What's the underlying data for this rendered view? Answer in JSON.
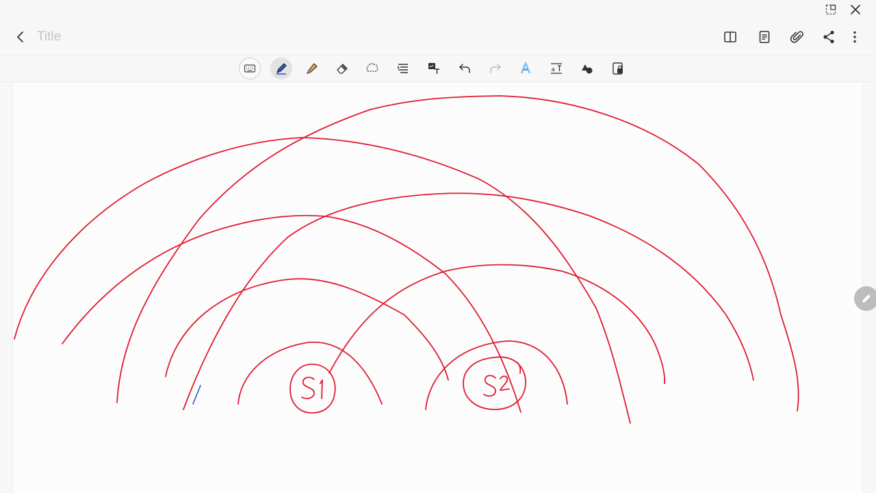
{
  "window": {
    "controls": [
      "popup-view-icon",
      "close-icon"
    ]
  },
  "header": {
    "back_icon": "chevron-left-icon",
    "title_placeholder": "Title",
    "title_value": "",
    "actions": [
      "book-view-icon",
      "page-template-icon",
      "attachment-icon",
      "share-icon",
      "more-options-icon"
    ]
  },
  "toolbar": {
    "tools": [
      "keyboard",
      "pen",
      "highlighter",
      "eraser",
      "lasso",
      "text-align",
      "handwriting-to-text",
      "undo",
      "redo",
      "text-style",
      "text-spacing",
      "shapes",
      "read-only-lock"
    ],
    "selected": "pen",
    "colors": {
      "pen_accent": "#2a5bd7",
      "highlighter": "#f2a64a",
      "active_text": "#2a8fe0"
    }
  },
  "canvas": {
    "labels": [
      "S1",
      "S2"
    ],
    "ink_color": "#e01b2f",
    "accent_stroke_color": "#2b55c9"
  },
  "floating_button": {
    "icon": "pen-icon"
  }
}
